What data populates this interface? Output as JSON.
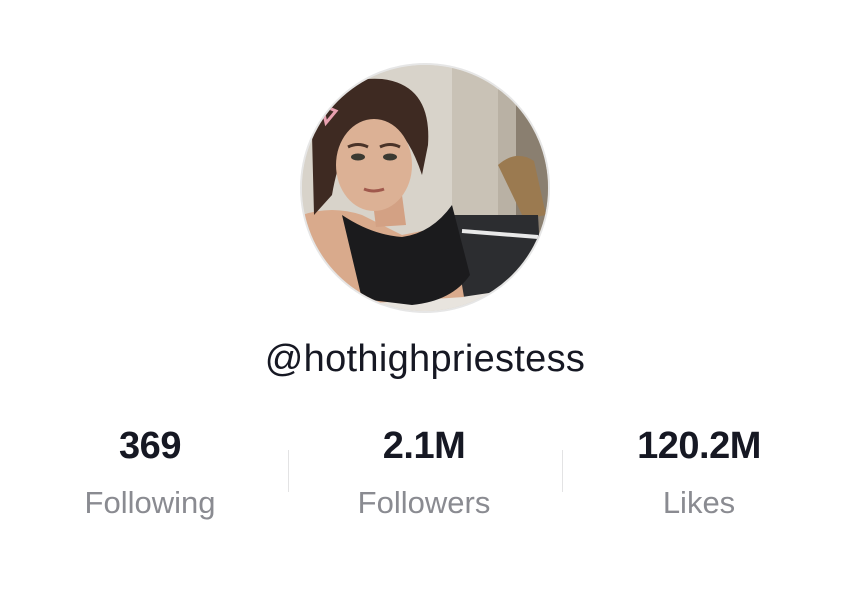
{
  "profile": {
    "username": "@hothighpriestess",
    "avatar_icon": "profile-photo",
    "stats": [
      {
        "value": "369",
        "label": "Following"
      },
      {
        "value": "2.1M",
        "label": "Followers"
      },
      {
        "value": "120.2M",
        "label": "Likes"
      }
    ]
  },
  "colors": {
    "primary_text": "#161823",
    "secondary_text": "#8a8b91",
    "divider": "#e3e3e4",
    "background": "#ffffff"
  }
}
